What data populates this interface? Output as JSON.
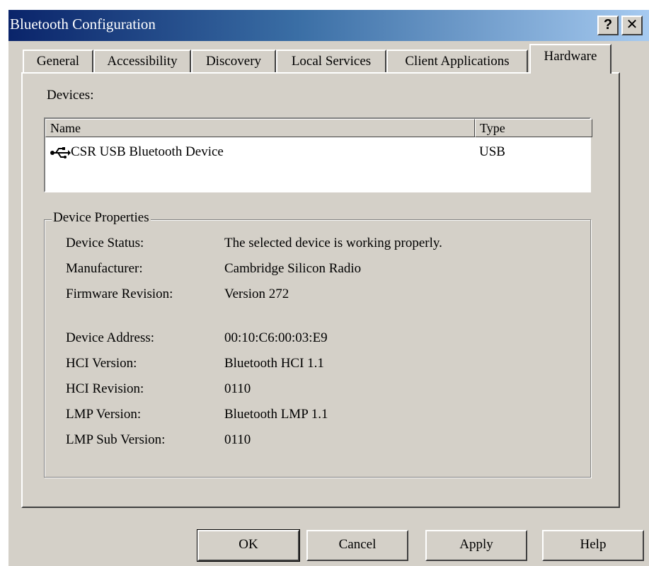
{
  "window": {
    "title": "Bluetooth Configuration",
    "help_button": "?",
    "close_button": "✕"
  },
  "tabs": [
    {
      "label": "General",
      "active": false
    },
    {
      "label": "Accessibility",
      "active": false
    },
    {
      "label": "Discovery",
      "active": false
    },
    {
      "label": "Local Services",
      "active": false
    },
    {
      "label": "Client Applications",
      "active": false
    },
    {
      "label": "Hardware",
      "active": true
    }
  ],
  "devices": {
    "label": "Devices:",
    "columns": [
      "Name",
      "Type"
    ],
    "rows": [
      {
        "icon": "usb-icon",
        "name": "CSR USB Bluetooth Device",
        "type": "USB"
      }
    ]
  },
  "properties": {
    "legend": "Device Properties",
    "items": [
      {
        "label": "Device Status:",
        "value": "The selected device is working properly."
      },
      {
        "label": "Manufacturer:",
        "value": "Cambridge Silicon Radio"
      },
      {
        "label": "Firmware Revision:",
        "value": "Version 272"
      },
      {
        "label": "Device Address:",
        "value": "00:10:C6:00:03:E9"
      },
      {
        "label": "HCI Version:",
        "value": "Bluetooth HCI 1.1"
      },
      {
        "label": "HCI Revision:",
        "value": "0110"
      },
      {
        "label": "LMP Version:",
        "value": "Bluetooth LMP 1.1"
      },
      {
        "label": "LMP Sub Version:",
        "value": "0110"
      }
    ]
  },
  "buttons": {
    "ok": "OK",
    "cancel": "Cancel",
    "apply": "Apply",
    "help": "Help"
  }
}
